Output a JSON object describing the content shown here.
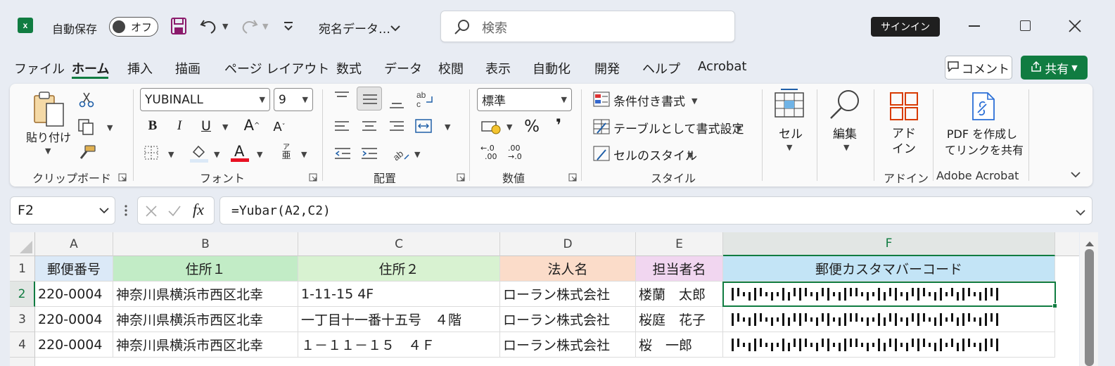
{
  "titlebar": {
    "app_logo_letter": "x",
    "autosave_label": "自動保存",
    "autosave_state": "オフ",
    "document_name": "宛名データ…",
    "search_placeholder": "検索",
    "signin_label": "サインイン"
  },
  "menu": {
    "tabs": [
      "ファイル",
      "ホーム",
      "挿入",
      "描画",
      "ページ レイアウト",
      "数式",
      "データ",
      "校閲",
      "表示",
      "自動化",
      "開発",
      "ヘルプ",
      "Acrobat"
    ],
    "active_tab": "ホーム",
    "comment_label": "コメント",
    "share_label": "共有"
  },
  "ribbon": {
    "clipboard": {
      "paste_label": "貼り付け",
      "group_label": "クリップボード"
    },
    "font": {
      "font_name": "YUBINALL",
      "font_size": "9",
      "bold": "B",
      "italic": "I",
      "underline": "U",
      "grow": "A",
      "shrink": "A",
      "font_color_glyph": "A",
      "phonetic_top": "ア",
      "phonetic_bottom": "亜",
      "group_label": "フォント"
    },
    "alignment": {
      "group_label": "配置"
    },
    "number": {
      "format": "標準",
      "percent": "%",
      "comma": "❜",
      "dec_up": "←.0",
      "dec_up2": ".00",
      "dec_down": ".00",
      "dec_down2": "→.0",
      "group_label": "数値"
    },
    "styles": {
      "conditional": "条件付き書式",
      "table": "テーブルとして書式設定",
      "cell_style": "セルのスタイル",
      "group_label": "スタイル"
    },
    "cells": {
      "label": "セル"
    },
    "editing": {
      "label": "編集"
    },
    "addins": {
      "label_line1": "アド",
      "label_line2": "イン",
      "group_label": "アドイン"
    },
    "acrobat": {
      "label_line1": "PDF を作成し",
      "label_line2": "てリンクを共有",
      "group_label": "Adobe Acrobat"
    }
  },
  "formula_bar": {
    "name_box": "F2",
    "fx": "fx",
    "formula": "=Yubar(A2,C2)"
  },
  "colors": {
    "excel_green": "#107c41",
    "header_a": "#dbe9f7",
    "header_b": "#c2ecc6",
    "header_c": "#d8f2d1",
    "header_d": "#fbdcc9",
    "header_e": "#f1d6f0",
    "header_f": "#c3e4f6"
  },
  "sheet": {
    "columns": [
      "A",
      "B",
      "C",
      "D",
      "E",
      "F"
    ],
    "selected_column": "F",
    "rows": [
      "1",
      "2",
      "3",
      "4"
    ],
    "selected_row": "2",
    "header": [
      "郵便番号",
      "住所１",
      "住所２",
      "法人名",
      "担当者名",
      "郵便カスタマバーコード"
    ],
    "data": [
      [
        "220-0004",
        "神奈川県横浜市西区北幸",
        "1-11-15 4F",
        "ローラン株式会社",
        "楼蘭　太郎"
      ],
      [
        "220-0004",
        "神奈川県横浜市西区北幸",
        "一丁目十一番十五号　４階",
        "ローラン株式会社",
        "桜庭　花子"
      ],
      [
        "220-0004",
        "神奈川県横浜市西区北幸",
        "１－１１－１５　４Ｆ",
        "ローラン株式会社",
        "桜　一郎"
      ]
    ]
  }
}
